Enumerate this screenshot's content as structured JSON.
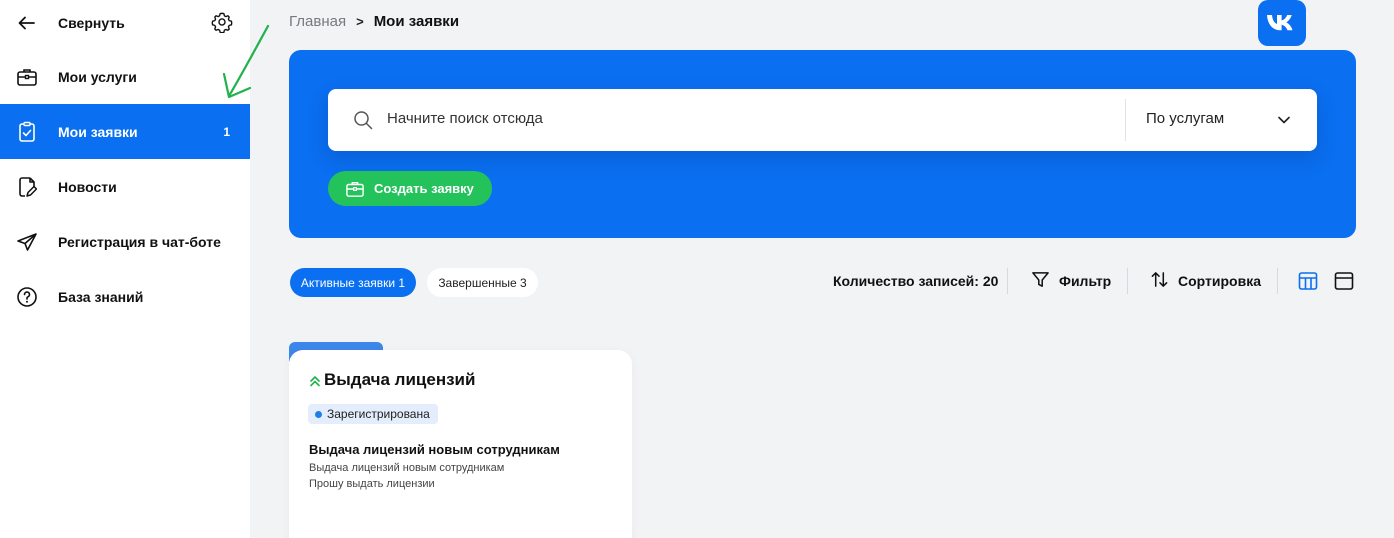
{
  "sidebar": {
    "collapse_label": "Свернуть",
    "items": [
      {
        "label": "Мои услуги",
        "icon": "briefcase-icon"
      },
      {
        "label": "Мои заявки",
        "icon": "clipboard-check-icon",
        "count": "1",
        "active": true
      },
      {
        "label": "Новости",
        "icon": "document-edit-icon"
      },
      {
        "label": "Регистрация в чат-боте",
        "icon": "send-icon"
      },
      {
        "label": "База знаний",
        "icon": "help-circle-icon"
      }
    ]
  },
  "breadcrumb": {
    "home": "Главная",
    "separator": ">",
    "current": "Мои заявки"
  },
  "search": {
    "placeholder": "Начните поиск отсюда",
    "scope_value": "По услугам"
  },
  "create_button": "Создать заявку",
  "tabs": {
    "active": "Активные заявки 1",
    "completed": "Завершенные 3"
  },
  "toolbar": {
    "records": "Количество записей: 20",
    "filter": "Фильтр",
    "sort": "Сортировка"
  },
  "card": {
    "title": "Выдача лицензий",
    "status": "Зарегистрирована",
    "subject": "Выдача лицензий новым сотрудникам",
    "desc_line1": "Выдача лицензий новым сотрудникам",
    "desc_line2": "Прошу выдать лицензии"
  },
  "colors": {
    "accent": "#0a6ff0",
    "success": "#24c25a",
    "background": "#f2f3f5",
    "annotation": "#22b24c"
  }
}
